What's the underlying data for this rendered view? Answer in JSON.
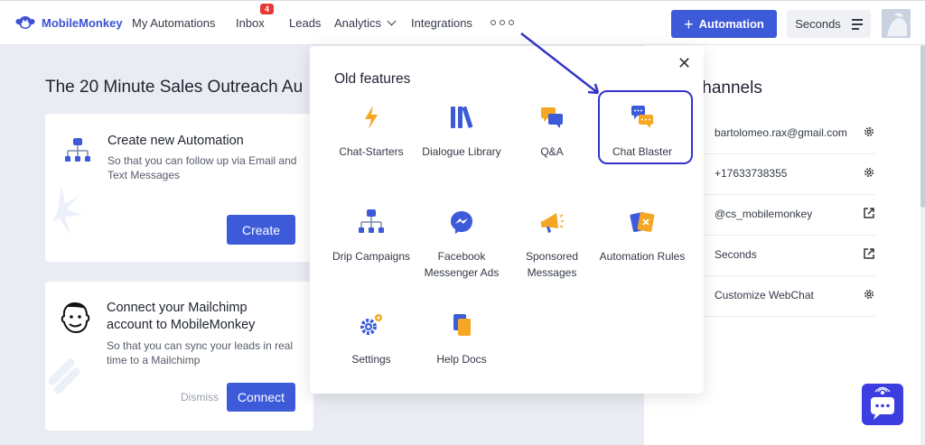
{
  "header": {
    "logo_text": "MobileMonkey",
    "nav": {
      "my_automations": "My Automations",
      "inbox": "Inbox",
      "inbox_badge": "4",
      "leads": "Leads",
      "analytics": "Analytics",
      "integrations": "Integrations"
    },
    "automation_button": "Automation",
    "seconds_button": "Seconds"
  },
  "main": {
    "page_title": "The 20 Minute Sales Outreach Au",
    "card_automation": {
      "title": "Create new Automation",
      "description": "So that you can follow up via Email and Text Messages",
      "button": "Create"
    },
    "card_mailchimp": {
      "title": "Connect your Mailchimp account to MobileMonkey",
      "description": "So that you can sync your leads in real time to a Mailchimp",
      "dismiss": "Dismiss",
      "button": "Connect"
    }
  },
  "channels": {
    "title": "y channels",
    "items": [
      {
        "label": "bartolomeo.rax@gmail.com",
        "icon": "gear-icon"
      },
      {
        "label": "+17633738355",
        "icon": "gear-icon"
      },
      {
        "label": "@cs_mobilemonkey",
        "icon": "external-link-icon"
      },
      {
        "label": "Seconds",
        "icon": "external-link-icon"
      },
      {
        "label": "Customize WebChat",
        "icon": "gear-icon"
      }
    ]
  },
  "popup": {
    "title": "Old features",
    "features": [
      {
        "label": "Chat-Starters",
        "icon": "lightning-icon"
      },
      {
        "label": "Dialogue Library",
        "icon": "library-icon"
      },
      {
        "label": "Q&A",
        "icon": "chat-bubbles-icon"
      },
      {
        "label": "Chat Blaster",
        "icon": "chat-blaster-icon"
      },
      {
        "label": "Drip Campaigns",
        "icon": "flow-icon"
      },
      {
        "label": "Facebook Messenger Ads",
        "icon": "messenger-icon"
      },
      {
        "label": "Sponsored Messages",
        "icon": "megaphone-icon"
      },
      {
        "label": "Automation Rules",
        "icon": "rules-icon"
      },
      {
        "label": "Settings",
        "icon": "settings-icon"
      },
      {
        "label": "Help Docs",
        "icon": "docs-icon"
      }
    ]
  },
  "colors": {
    "brand_blue": "#3d5bd9",
    "highlight": "#3333c9",
    "background": "#e9ecf2",
    "orange": "#f5a623"
  }
}
